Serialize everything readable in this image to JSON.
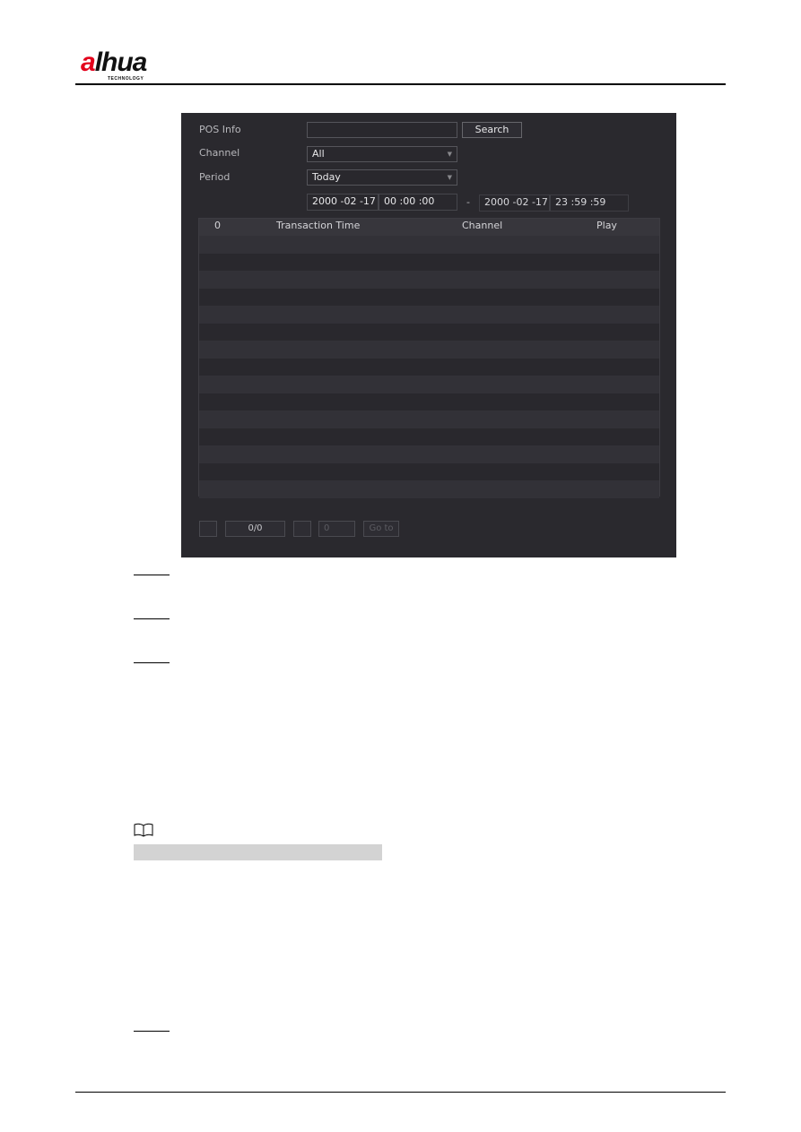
{
  "header": {
    "brand": "alhua",
    "brand_first": "a",
    "brand_rest": "lhua",
    "tagline": "TECHNOLOGY",
    "brand_color": "#e3001b"
  },
  "form": {
    "pos_info_label": "POS Info",
    "pos_info_value": "",
    "search_button": "Search",
    "channel_label": "Channel",
    "channel_value": "All",
    "period_label": "Period",
    "period_value": "Today",
    "start_date": "2000 -02 -17",
    "start_time": "00 :00 :00",
    "range_separator": "-",
    "end_date": "2000 -02 -17",
    "end_time": "23 :59 :59"
  },
  "table": {
    "columns": [
      "0",
      "Transaction Time",
      "Channel",
      "Play"
    ],
    "row_count_visible": 15,
    "rows": []
  },
  "pager": {
    "prev_label": "",
    "page_indicator": "0/0",
    "next_label": "",
    "page_input": "0",
    "goto_label": "Go to"
  }
}
